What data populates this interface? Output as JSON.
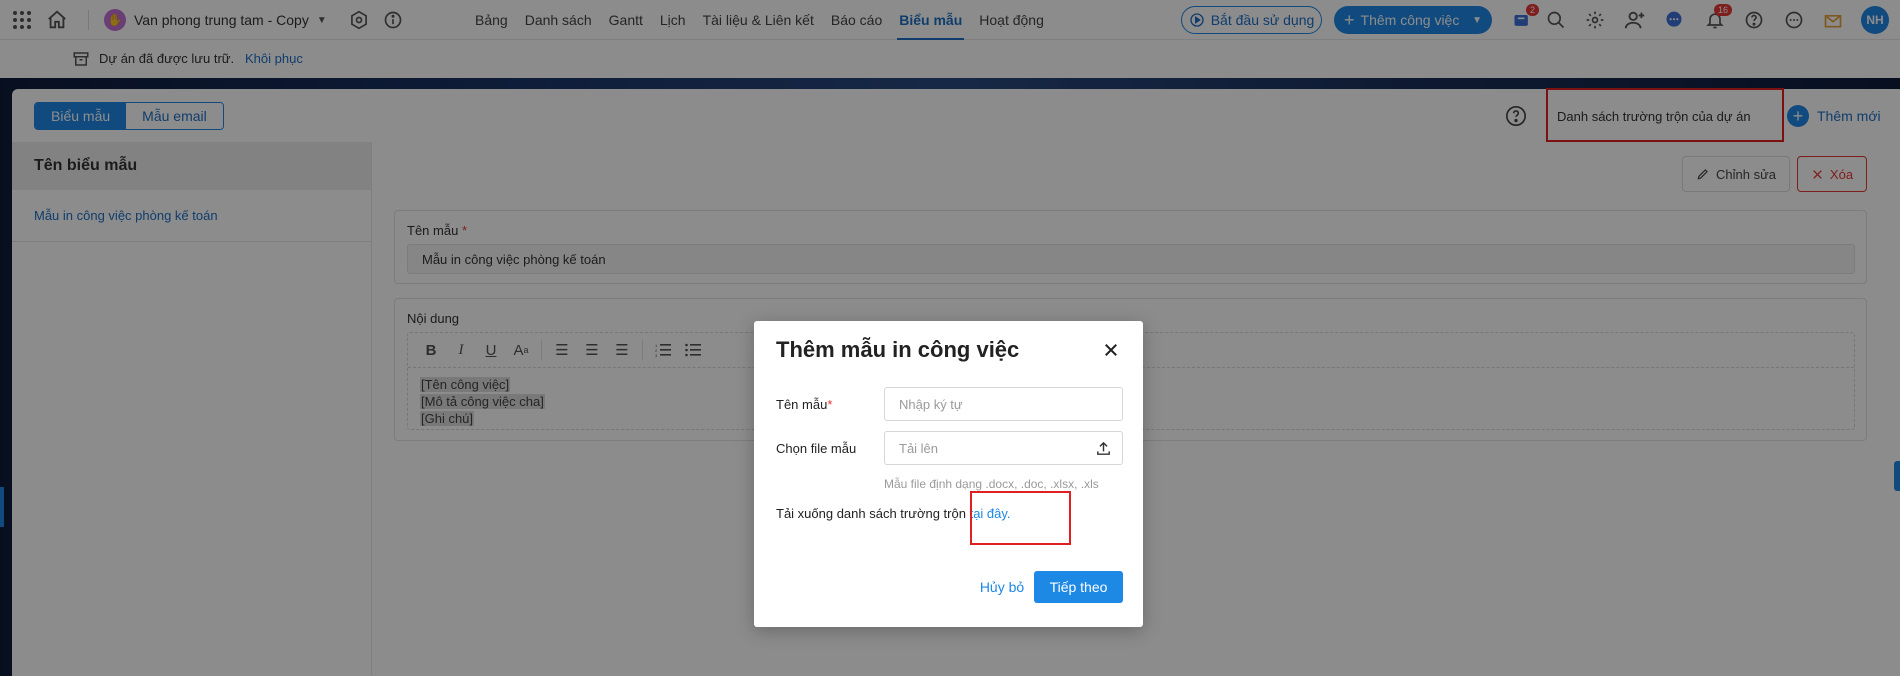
{
  "topbar": {
    "project_name": "Van phong trung tam - Copy",
    "nav": [
      "Bảng",
      "Danh sách",
      "Gantt",
      "Lịch",
      "Tài liệu & Liên kết",
      "Báo cáo",
      "Biểu mẫu",
      "Hoạt động"
    ],
    "active_nav": "Biểu mẫu",
    "start_label": "Bắt đầu sử dụng",
    "add_task_label": "Thêm công việc",
    "cart_badge": "2",
    "notif_badge": "16",
    "avatar": "NH",
    "colors": {
      "accent": "#1e88e5",
      "badge": "#e53935",
      "project_logo": "#c46fd6"
    }
  },
  "archive": {
    "message": "Dự án đã được lưu trữ.",
    "restore_label": "Khôi phục"
  },
  "tabs": {
    "forms": "Biểu mẫu",
    "email": "Mẫu email"
  },
  "header": {
    "merge_fields_label": "Danh sách trường trộn của dự án",
    "add_new_label": "Thêm mới"
  },
  "sidebar": {
    "title": "Tên biểu mẫu",
    "items": [
      "Mẫu in công việc phòng kế toán"
    ]
  },
  "detail": {
    "edit_label": "Chỉnh sửa",
    "delete_label": "Xóa",
    "name_label": "Tên mẫu",
    "name_value": "Mẫu in công việc phòng kế toán",
    "content_label": "Nội dung",
    "content_lines": [
      "[Tên công việc]",
      "[Mô tả công việc cha]",
      "[Ghi chú]"
    ]
  },
  "modal": {
    "title": "Thêm mẫu in công việc",
    "name_label": "Tên mẫu",
    "name_placeholder": "Nhập ký tự",
    "file_label": "Chọn file mẫu",
    "file_placeholder": "Tải lên",
    "hint": "Mẫu file định dạng .docx, .doc, .xlsx, .xls",
    "download_text": "Tải xuống danh sách trường trộn",
    "download_link": "tại đây.",
    "cancel_label": "Hủy bỏ",
    "next_label": "Tiếp theo"
  }
}
